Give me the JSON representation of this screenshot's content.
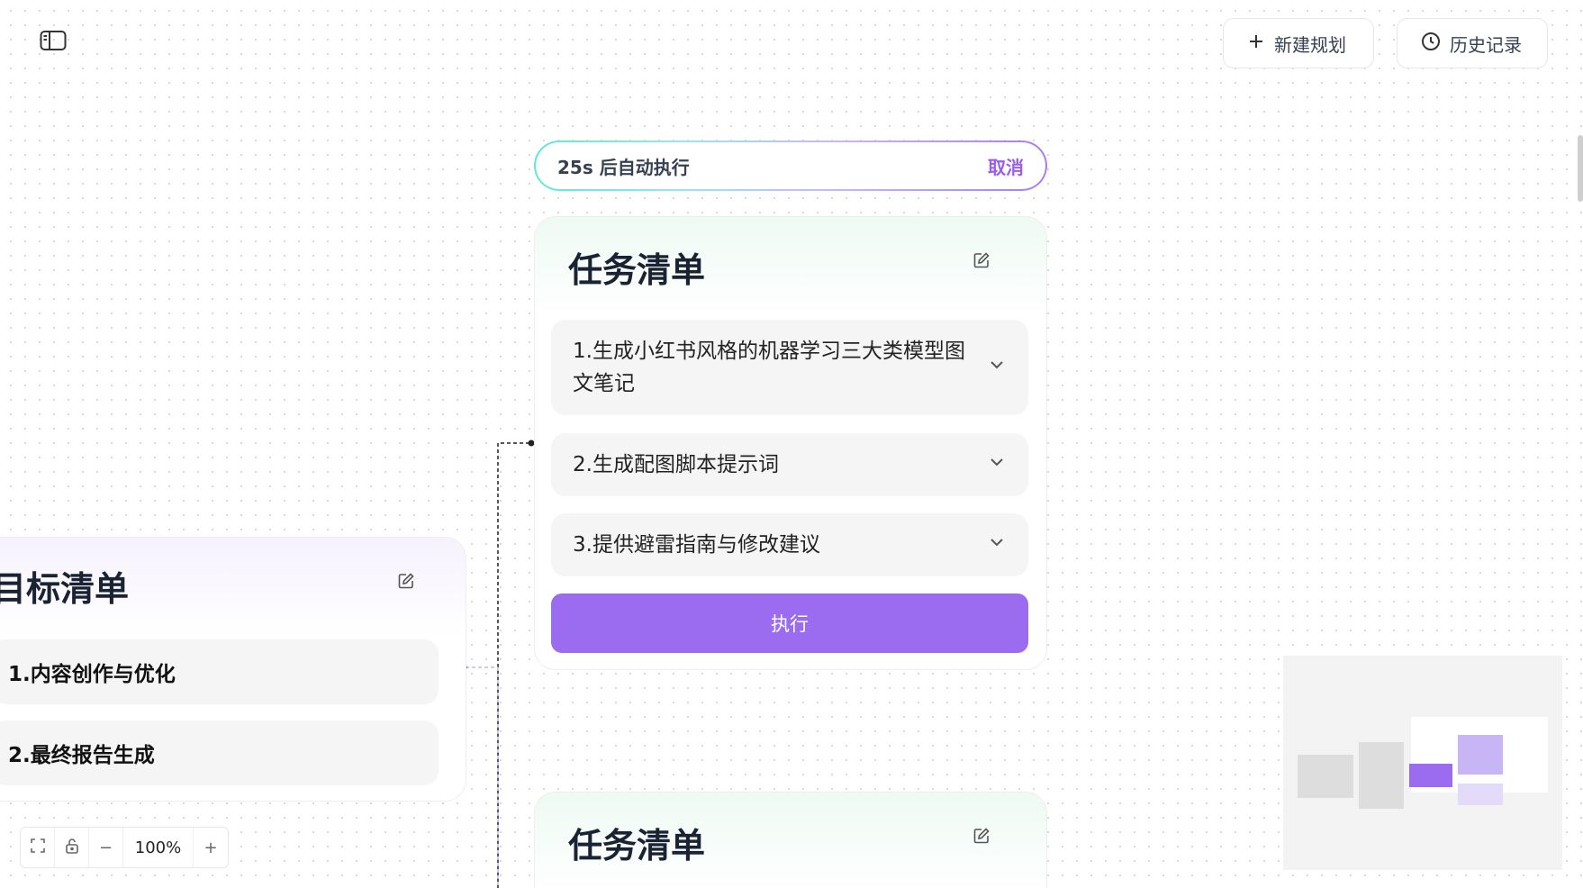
{
  "header": {
    "new_plan_label": "新建规划",
    "history_label": "历史记录"
  },
  "countdown": {
    "text": "25s 后自动执行",
    "cancel_label": "取消"
  },
  "task_card": {
    "title": "任务清单",
    "items": [
      {
        "label": "1.生成小红书风格的机器学习三大类模型图文笔记"
      },
      {
        "label": "2.生成配图脚本提示词"
      },
      {
        "label": "3.提供避雷指南与修改建议"
      }
    ],
    "execute_label": "执行"
  },
  "task_card_2": {
    "title": "任务清单"
  },
  "goal_card": {
    "title": "目标清单",
    "items": [
      {
        "label": "1.内容创作与优化"
      },
      {
        "label": "2.最终报告生成"
      }
    ]
  },
  "zoom": {
    "level": "100%",
    "minus": "−",
    "plus": "+"
  },
  "icons": {
    "sidebar": "sidebar-toggle-icon",
    "plus": "plus-icon",
    "clock": "clock-icon",
    "edit": "edit-icon",
    "chevron": "chevron-down-icon",
    "fit": "fit-view-icon",
    "lock": "unlock-icon"
  },
  "colors": {
    "accent": "#9b6cf0",
    "cancel": "#9b5cf0"
  }
}
